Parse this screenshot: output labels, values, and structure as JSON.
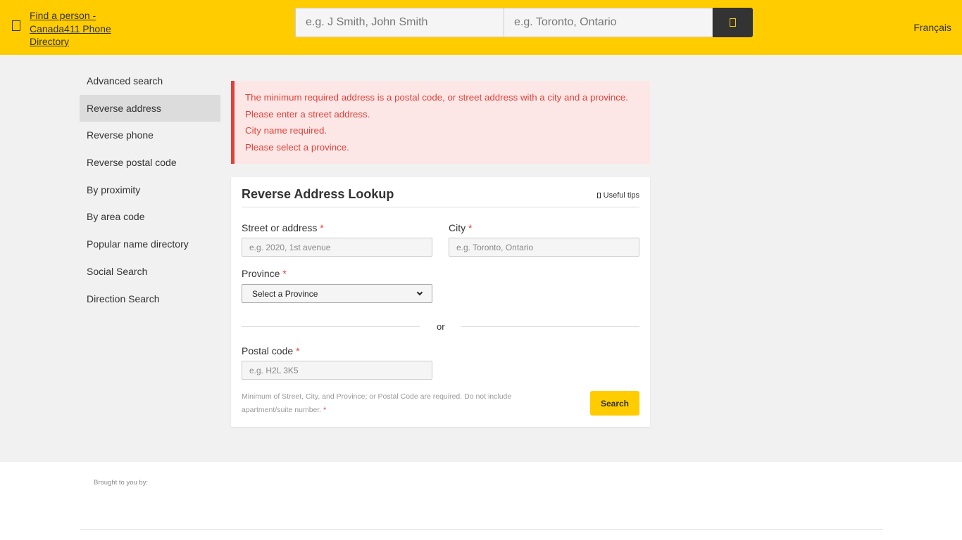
{
  "header": {
    "logo_alt": "Find a person - Canada411 Phone Directory",
    "search_name_placeholder": "e.g. J Smith, John Smith",
    "search_location_placeholder": "e.g. Toronto, Ontario",
    "language_link": "Français",
    "brand_color": "#ffcc00",
    "menu_icon": "hamburger-icon",
    "search_icon": "search-icon"
  },
  "sidebar": {
    "items": [
      {
        "label": "Advanced search",
        "active": false
      },
      {
        "label": "Reverse address",
        "active": true
      },
      {
        "label": "Reverse phone",
        "active": false
      },
      {
        "label": "Reverse postal code",
        "active": false
      },
      {
        "label": "By proximity",
        "active": false
      },
      {
        "label": "By area code",
        "active": false
      },
      {
        "label": "Popular name directory",
        "active": false
      },
      {
        "label": "Social Search",
        "active": false
      },
      {
        "label": "Direction Search",
        "active": false
      }
    ]
  },
  "alert": {
    "color": "#e0413a",
    "messages": [
      "The minimum required address is a postal code, or street address with a city and a province.",
      "Please enter a street address.",
      "City name required.",
      "Please select a province."
    ]
  },
  "form": {
    "title": "Reverse Address Lookup",
    "tips_label": "Useful tips",
    "street_label": "Street or address",
    "street_placeholder": "e.g. 2020, 1st avenue",
    "city_label": "City",
    "city_placeholder": "e.g. Toronto, Ontario",
    "province_label": "Province",
    "province_selected": "Select a Province",
    "or_text": "or",
    "postal_label": "Postal code",
    "postal_placeholder": "e.g. H2L 3K5",
    "required_mark": "*",
    "help_text": "Minimum of Street, City, and Province; or Postal Code are required. Do not include apartment/suite number.",
    "submit_label": "Search"
  },
  "footer": {
    "brought_by": "Brought to you by:"
  }
}
